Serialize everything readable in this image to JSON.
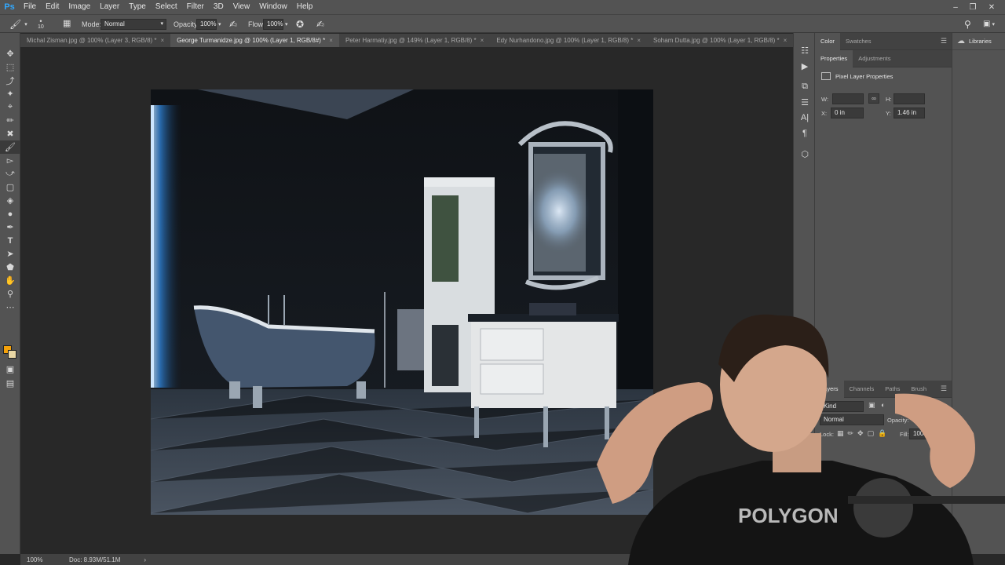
{
  "app": {
    "logo": "Ps"
  },
  "menu": [
    "File",
    "Edit",
    "Image",
    "Layer",
    "Type",
    "Select",
    "Filter",
    "3D",
    "View",
    "Window",
    "Help"
  ],
  "options": {
    "brush_size": "10",
    "mode_label": "Mode:",
    "mode_value": "Normal",
    "opacity_label": "Opacity:",
    "opacity_value": "100%",
    "flow_label": "Flow:",
    "flow_value": "100%"
  },
  "tabs": [
    {
      "label": "Michal Zisman.jpg @ 100% (Layer 3, RGB/8) *",
      "active": false
    },
    {
      "label": "George Turmanidze.jpg @ 100% (Layer 1, RGB/8#) *",
      "active": true
    },
    {
      "label": "Peter Harmatiy.jpg @ 149% (Layer 1, RGB/8) *",
      "active": false
    },
    {
      "label": "Edy Nurhandono.jpg @ 100% (Layer 1, RGB/8) *",
      "active": false
    },
    {
      "label": "Soham Dutta.jpg @ 100% (Layer 1, RGB/8) *",
      "active": false
    }
  ],
  "status": {
    "zoom": "100%",
    "doc": "Doc: 8.93M/51.1M"
  },
  "panels": {
    "color_tabs": [
      "Color",
      "Swatches"
    ],
    "prop_tabs": [
      "Properties",
      "Adjustments"
    ],
    "prop_title": "Pixel Layer Properties",
    "w_label": "W:",
    "h_label": "H:",
    "x_label": "X:",
    "x_value": "0 in",
    "y_label": "Y:",
    "y_value": "1.46 in",
    "layers_tabs": [
      "Layers",
      "Channels",
      "Paths",
      "Brush"
    ],
    "kind_value": "Kind",
    "blend_value": "Normal",
    "opacity_label": "Opacity:",
    "lock_label": "Lock:",
    "fill_label": "Fill:",
    "fill_value": "100%",
    "libraries": "Libraries"
  },
  "shirt_text": "POLYGON",
  "colors": {
    "foreground": "#f4a10a",
    "background": "#e9d7a5",
    "accent": "#31a8ff"
  }
}
